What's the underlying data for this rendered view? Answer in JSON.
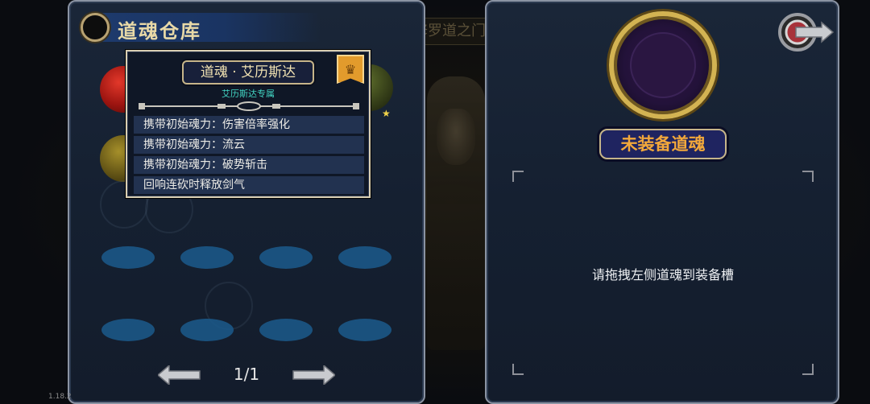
{
  "background": {
    "faint_title": "修罗道之门"
  },
  "version": "1.18.2",
  "left_panel": {
    "title": "道魂仓库",
    "page_indicator": "1/1"
  },
  "tooltip": {
    "name": "道魂 · 艾历斯达",
    "subtitle": "艾历斯达专属",
    "badge_icon": "rank-badge-icon",
    "effects": [
      "携带初始魂力：伤害倍率强化",
      "携带初始魂力：流云",
      "携带初始魂力：破势斩击",
      "回响连砍时释放剑气"
    ]
  },
  "right_panel": {
    "equip_status": "未装备道魂",
    "drop_hint": "请拖拽左侧道魂到装备槽"
  },
  "colors": {
    "panel_bg": "#152031",
    "header_blue": "#1e3b6e",
    "gold_text": "#e8d9a7",
    "equip_label_text": "#f2a83b",
    "subtitle_cyan": "#42d6c4",
    "slot_blue": "#1b5a8c"
  }
}
